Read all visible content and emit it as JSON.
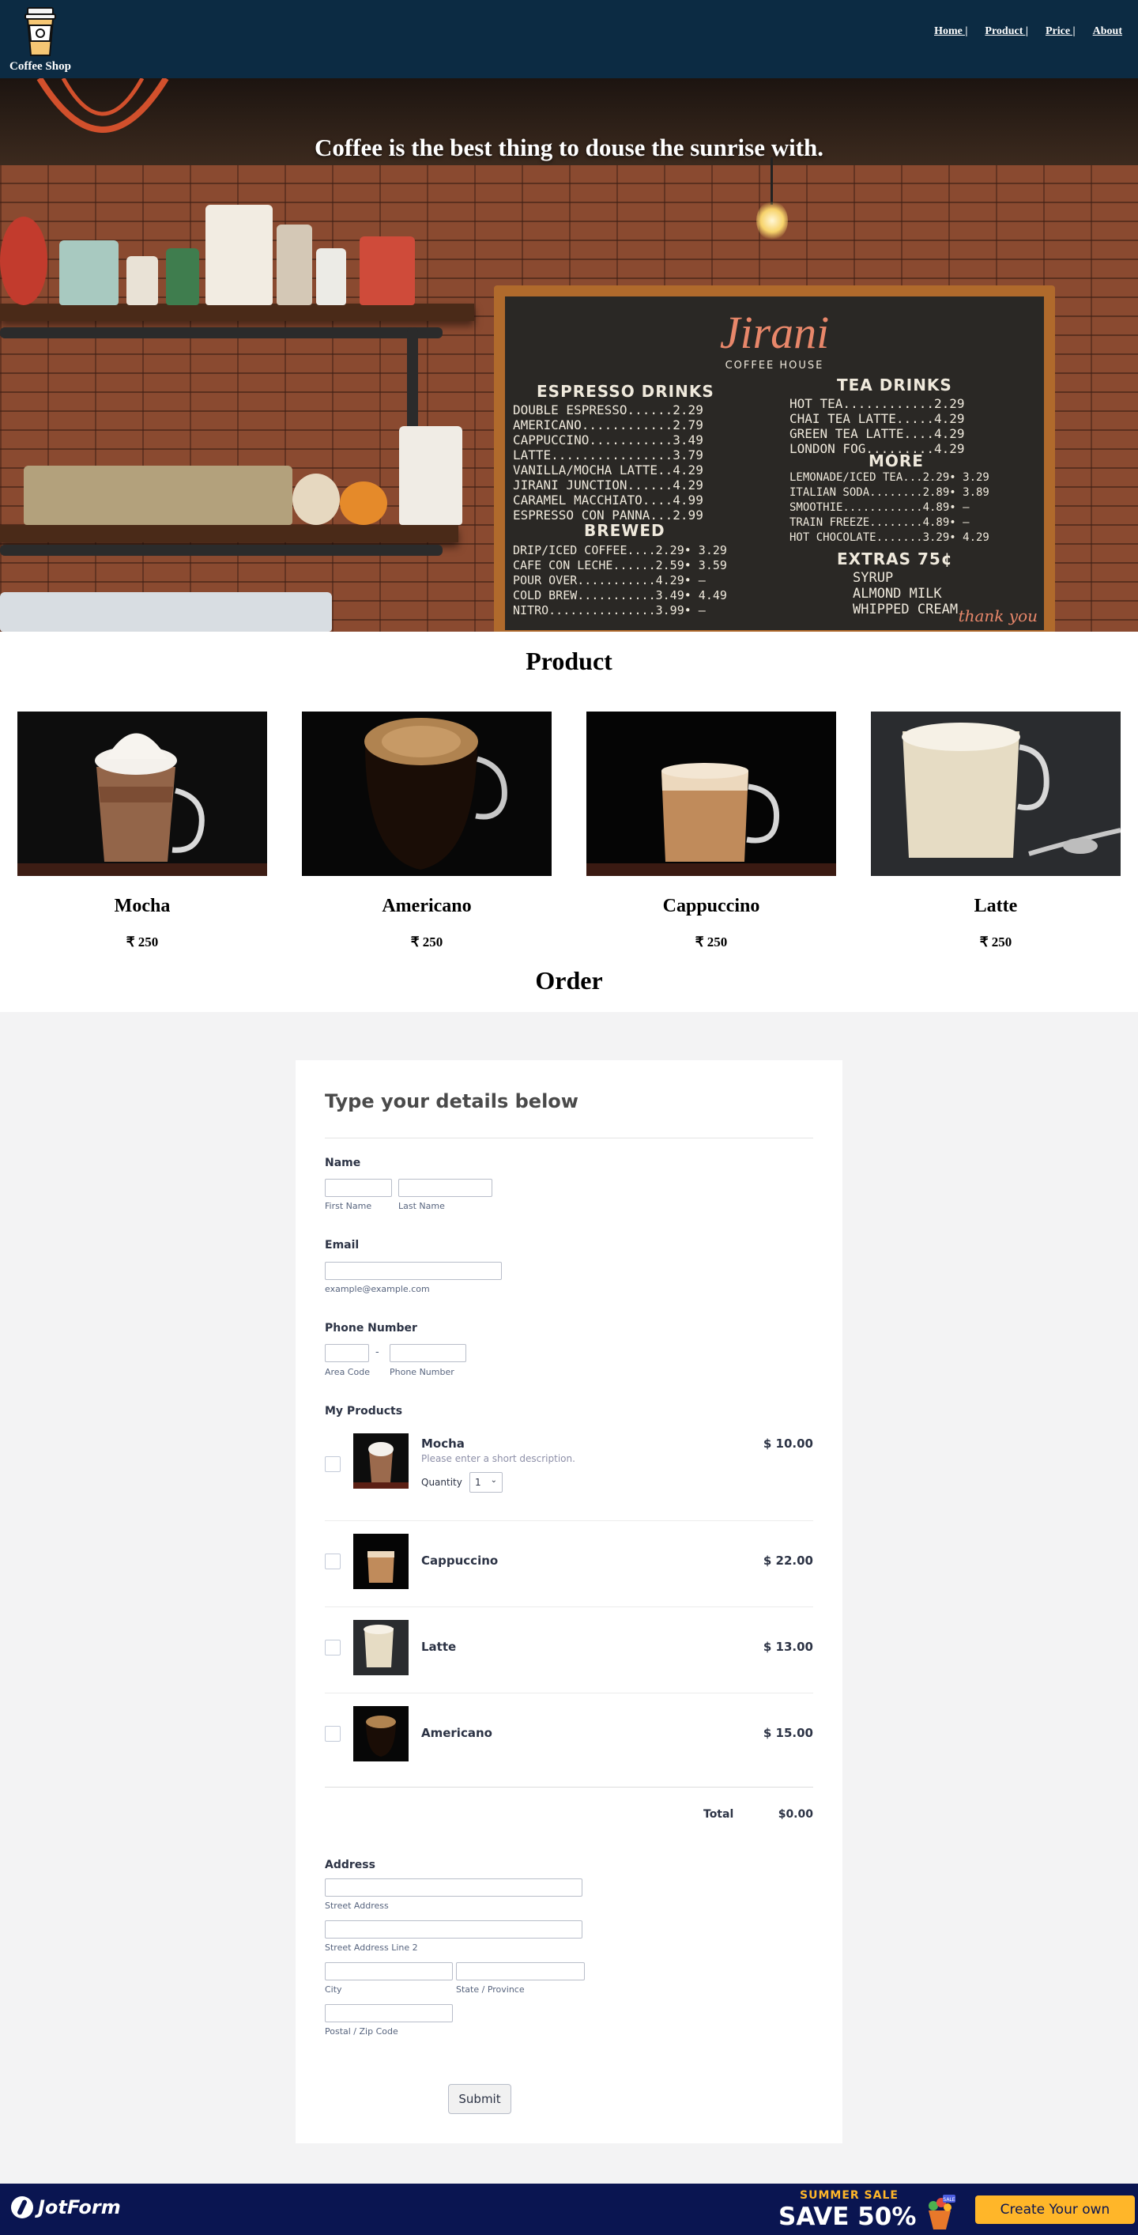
{
  "header": {
    "brand": "Coffee Shop",
    "nav": [
      "Home |",
      "Product |",
      "Price |",
      "About"
    ]
  },
  "hero": {
    "tagline": "Coffee is the best thing to douse the sunrise with.",
    "board": {
      "title": "Jirani",
      "subtitle": "COFFEE HOUSE",
      "espresso_head": "ESPRESSO DRINKS",
      "espresso": "DOUBLE ESPRESSO......2.29\nAMERICANO............2.79\nCAPPUCCINO...........3.49\nLATTE................3.79\nVANILLA/MOCHA LATTE..4.29\nJIRANI JUNCTION......4.29\nCARAMEL MACCHIATO....4.99\nESPRESSO CON PANNA...2.99",
      "tea_head": "TEA DRINKS",
      "tea": "HOT TEA............2.29\nCHAI TEA LATTE.....4.29\nGREEN TEA LATTE....4.29\nLONDON FOG.........4.29",
      "more_head": "MORE",
      "more": "LEMONADE/ICED TEA...2.29• 3.29\nITALIAN SODA........2.89• 3.89\nSMOOTHIE............4.89• —\nTRAIN FREEZE........4.89• —\nHOT CHOCOLATE.......3.29• 4.29",
      "brewed_head": "BREWED",
      "brewed": "DRIP/ICED COFFEE....2.29• 3.29\nCAFE CON LECHE......2.59• 3.59\nPOUR OVER...........4.29• —\nCOLD BREW...........3.49• 4.49\nNITRO...............3.99• —",
      "extras_head": "EXTRAS 75¢",
      "extras": "SYRUP\nALMOND MILK\nWHIPPED CREAM",
      "thank": "thank you"
    }
  },
  "products": {
    "title": "Product",
    "items": [
      {
        "name": "Mocha",
        "price": "₹ 250"
      },
      {
        "name": "Americano",
        "price": "₹ 250"
      },
      {
        "name": "Cappuccino",
        "price": "₹ 250"
      },
      {
        "name": "Latte",
        "price": "₹ 250"
      }
    ]
  },
  "order": {
    "title": "Order",
    "form": {
      "heading": "Type your details below",
      "name_label": "Name",
      "first_name_sub": "First Name",
      "last_name_sub": "Last Name",
      "email_label": "Email",
      "email_sub": "example@example.com",
      "phone_label": "Phone Number",
      "area_code_sub": "Area Code",
      "phone_sub": "Phone Number",
      "phone_dash": "-",
      "products_label": "My Products",
      "items": [
        {
          "name": "Mocha",
          "price": "$ 10.00",
          "desc": "Please enter a short description.",
          "qty_label": "Quantity",
          "qty": "1"
        },
        {
          "name": "Cappuccino",
          "price": "$ 22.00"
        },
        {
          "name": "Latte",
          "price": "$ 13.00"
        },
        {
          "name": "Americano",
          "price": "$ 15.00"
        }
      ],
      "total_label": "Total",
      "total_value": "$0.00",
      "address_label": "Address",
      "street_sub": "Street Address",
      "street2_sub": "Street Address Line 2",
      "city_sub": "City",
      "state_sub": "State / Province",
      "zip_sub": "Postal / Zip Code",
      "submit": "Submit"
    }
  },
  "footer": {
    "brand": "JotForm",
    "sale_top": "SUMMER SALE",
    "sale_big": "SAVE 50%",
    "sale_badge": "SALE",
    "cta": "Create Your own JotForm",
    "colors": {
      "bg": "#0a1551",
      "accent": "#ffb629"
    }
  },
  "colors": {
    "header_bg": "#0c2b43",
    "order_bg": "#f3f3f4"
  }
}
